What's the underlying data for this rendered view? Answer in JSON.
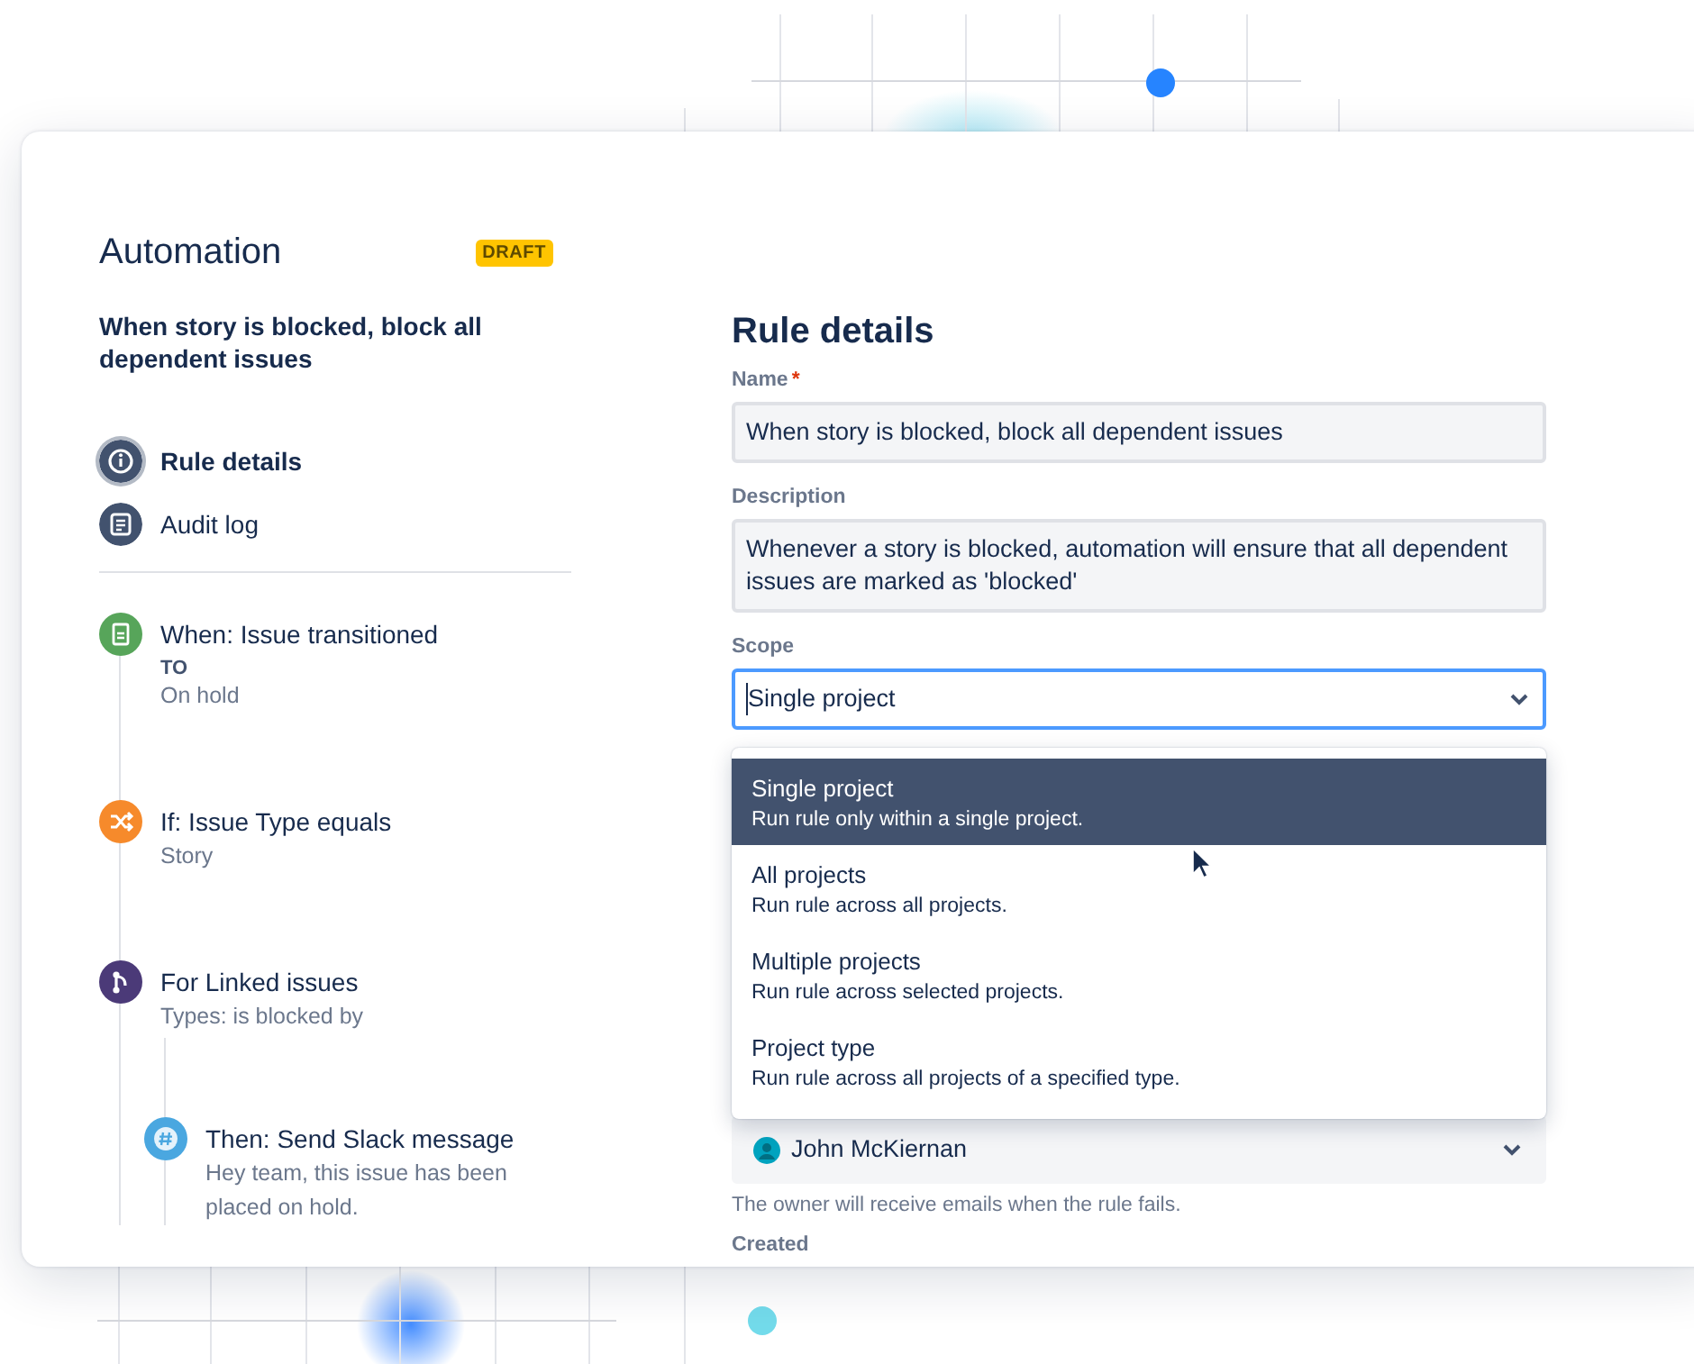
{
  "sidebar": {
    "title": "Automation",
    "badge": "DRAFT",
    "rule_name": "When story is blocked, block all dependent issues",
    "nav": [
      {
        "kind": "info",
        "label": "Rule details",
        "selected": true
      },
      {
        "kind": "log",
        "label": "Audit log",
        "selected": false
      }
    ],
    "steps": [
      {
        "kind": "trigger",
        "color": "#57a55a",
        "title": "When: Issue transitioned",
        "details": [
          {
            "kind": "label",
            "text": "TO"
          },
          {
            "kind": "text",
            "text": "On hold"
          }
        ]
      },
      {
        "kind": "condition",
        "color": "#f68a2b",
        "title": "If: Issue Type equals",
        "details": [
          {
            "kind": "text",
            "text": "Story"
          }
        ]
      },
      {
        "kind": "branch",
        "color": "#4b3a78",
        "title": "For Linked issues",
        "details": [
          {
            "kind": "text",
            "text": "Types: is blocked by"
          }
        ],
        "children": [
          {
            "kind": "action",
            "color": "#4aa7e0",
            "title": "Then: Send Slack message",
            "details": [
              {
                "kind": "text",
                "text": "Hey team, this issue has been placed on hold."
              }
            ]
          }
        ]
      }
    ]
  },
  "form": {
    "heading": "Rule details",
    "name_field": {
      "label": "Name",
      "required_mark": "*",
      "value": "When story is blocked, block all dependent issues"
    },
    "description_field": {
      "label": "Description",
      "value": "Whenever a story is blocked, automation will ensure that all dependent issues are marked as 'blocked'"
    },
    "scope_field": {
      "label": "Scope",
      "value": "Single project",
      "focused": true,
      "options": [
        {
          "title": "Single project",
          "description": "Run rule only within a single project.",
          "selected": true
        },
        {
          "title": "All projects",
          "description": "Run rule across all projects.",
          "selected": false
        },
        {
          "title": "Multiple projects",
          "description": "Run rule across selected projects.",
          "selected": false
        },
        {
          "title": "Project type",
          "description": "Run rule across all projects of a specified type.",
          "selected": false
        }
      ]
    },
    "owner_field": {
      "value": "John McKiernan",
      "hint": "The owner will receive emails when the rule fails."
    },
    "created_label": "Created"
  }
}
